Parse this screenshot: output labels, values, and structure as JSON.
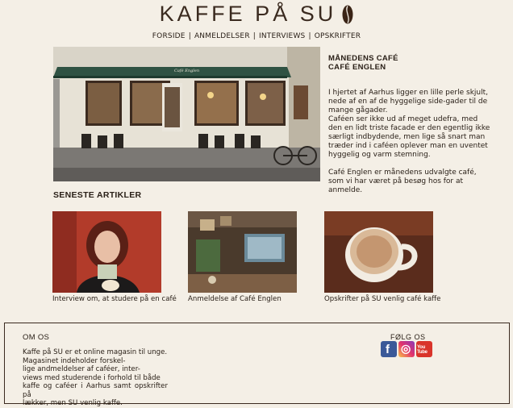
{
  "header": {
    "logo_text": "KAFFE PÅ SU",
    "nav": [
      {
        "label": "FORSIDE"
      },
      {
        "label": "ANMELDELSER"
      },
      {
        "label": "INTERVIEWS"
      },
      {
        "label": "OPSKRIFTER"
      }
    ],
    "nav_separator": "|"
  },
  "month_cafe": {
    "heading_1": "MÅNEDENS CAFÉ",
    "heading_2": "CAFÉ ENGLEN",
    "paragraph_1": "I hjertet af Aarhus ligger en lille perle skjult, nede af en af de hyggelige side-gader til de mange gågader.",
    "paragraph_2": "Caféen ser ikke ud af meget udefra, med den en lidt triste facade er den egentlig ikke særligt indbydende, men lige så snart man træder ind i caféen oplever man en uventet hyggelig og varm stemning.",
    "paragraph_3": "Café Englen er månedens udvalgte café, som vi har været på besøg hos for at anmelde.",
    "awning_sign": "Café Englen"
  },
  "latest": {
    "title": "SENESTE ARTIKLER",
    "articles": [
      {
        "caption": "Interview om, at studere på en café"
      },
      {
        "caption": "Anmeldelse af Café Englen"
      },
      {
        "caption": "Opskrifter på SU venlig café kaffe"
      }
    ]
  },
  "footer": {
    "about_title": "OM OS",
    "about_lines": [
      "Kaffe på SU er et online magasin til unge.",
      "Magasinet indeholder forskel-",
      "lige andmeldelser af caféer, inter-",
      "views med studerende i forhold til både",
      "kaffe og caféer i Aarhus samt opskrifter på",
      "lækker, men SU venlig kaffe."
    ],
    "follow_title": "FØLG OS",
    "social": [
      {
        "icon": "facebook-icon",
        "glyph": "f",
        "color": "#3b5998"
      },
      {
        "icon": "instagram-icon",
        "glyph": "◎",
        "color": "#e2336c"
      },
      {
        "icon": "youtube-icon",
        "glyph": "You Tube",
        "color": "#d9342a"
      }
    ]
  },
  "colors": {
    "background": "#f4efe6",
    "text": "#2a2018",
    "awning": "#2f5243"
  }
}
